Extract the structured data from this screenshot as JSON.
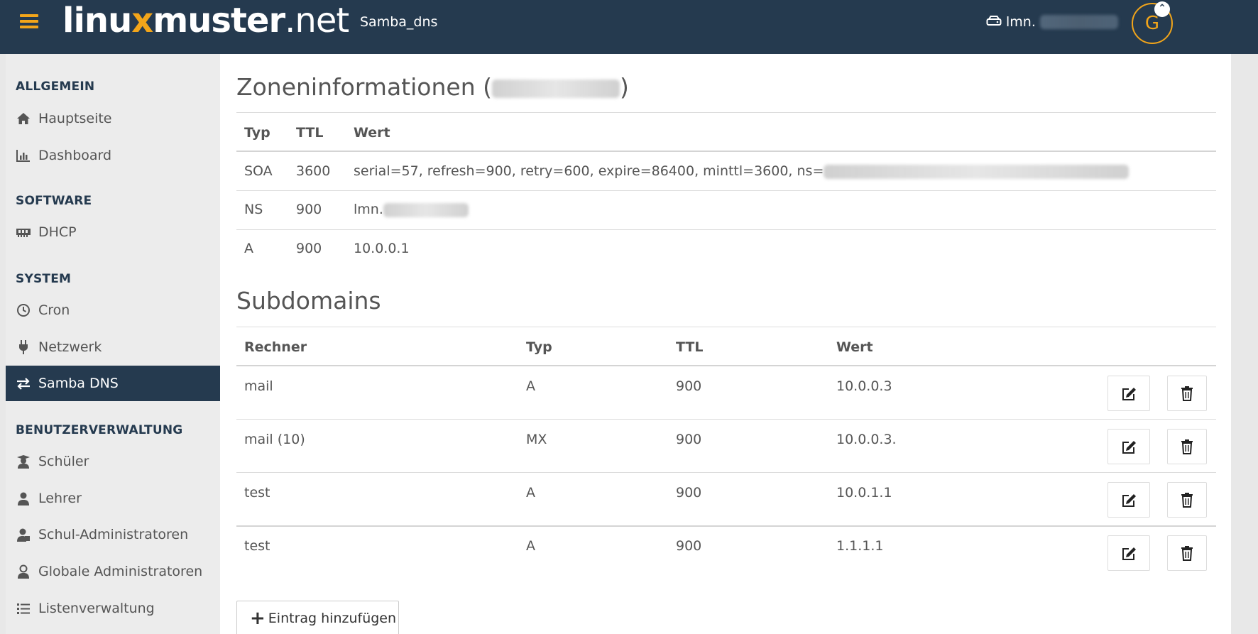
{
  "header": {
    "logo_left": "linu",
    "logo_mark": "x",
    "logo_mid": "muster",
    "logo_net": ".net",
    "page_name": "Samba_dns",
    "host_label": "lmn.",
    "avatar_letter": "G",
    "accent": "#f2a51a",
    "bar_color": "#253a4f"
  },
  "sidebar": {
    "sections": [
      {
        "title": "ALLGEMEIN"
      },
      {
        "title": "SOFTWARE"
      },
      {
        "title": "SYSTEM"
      },
      {
        "title": "BENUTZERVERWALTUNG"
      }
    ],
    "items": [
      {
        "label": "Hauptseite",
        "icon": "home-icon"
      },
      {
        "label": "Dashboard",
        "icon": "bar-chart-icon"
      },
      {
        "label": "DHCP",
        "icon": "network-card-icon"
      },
      {
        "label": "Cron",
        "icon": "clock-icon"
      },
      {
        "label": "Netzwerk",
        "icon": "plug-icon"
      },
      {
        "label": "Samba DNS",
        "icon": "exchange-arrows-icon",
        "active": true
      },
      {
        "label": "Schüler",
        "icon": "student-icon"
      },
      {
        "label": "Lehrer",
        "icon": "teacher-icon"
      },
      {
        "label": "Schul-Administratoren",
        "icon": "school-admin-icon"
      },
      {
        "label": "Globale Administratoren",
        "icon": "global-admin-icon"
      },
      {
        "label": "Listenverwaltung",
        "icon": "list-icon"
      }
    ]
  },
  "zone": {
    "title_prefix": "Zoneninformationen (",
    "title_suffix": ")",
    "headers": [
      "Typ",
      "TTL",
      "Wert"
    ],
    "rows": [
      {
        "typ": "SOA",
        "ttl": "3600",
        "wert": "serial=57, refresh=900, retry=600, expire=86400, minttl=3600, ns="
      },
      {
        "typ": "NS",
        "ttl": "900",
        "wert": "lmn."
      },
      {
        "typ": "A",
        "ttl": "900",
        "wert": "10.0.0.1"
      }
    ]
  },
  "subdomains": {
    "title": "Subdomains",
    "headers": [
      "Rechner",
      "Typ",
      "TTL",
      "Wert"
    ],
    "rows": [
      {
        "rechner": "mail",
        "typ": "A",
        "ttl": "900",
        "wert": "10.0.0.3"
      },
      {
        "rechner": "mail (10)",
        "typ": "MX",
        "ttl": "900",
        "wert": "10.0.0.3."
      },
      {
        "rechner": "test",
        "typ": "A",
        "ttl": "900",
        "wert": "10.0.1.1"
      },
      {
        "rechner": "test",
        "typ": "A",
        "ttl": "900",
        "wert": "1.1.1.1"
      }
    ],
    "edit_icon": "edit-icon",
    "delete_icon": "trash-icon"
  },
  "actions": {
    "add_label": "Eintrag hinzufügen"
  }
}
